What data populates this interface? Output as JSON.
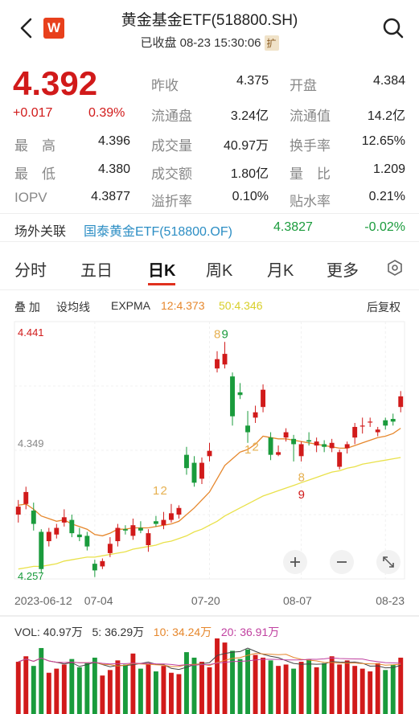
{
  "header": {
    "title": "黄金基金ETF(518800.SH)",
    "status": "已收盘 08-23 15:30:06",
    "ext_badge": "扩",
    "logo": "W"
  },
  "quote": {
    "price": "4.392",
    "change": "+0.017",
    "change_pct": "0.39%",
    "rows": [
      [
        {
          "l": "最　高",
          "v": "4.396"
        },
        {
          "l": "成交量",
          "v": "40.97万"
        },
        {
          "l": "换手率",
          "v": "12.65%"
        }
      ],
      [
        {
          "l": "最　低",
          "v": "4.380"
        },
        {
          "l": "成交额",
          "v": "1.80亿"
        },
        {
          "l": "量　比",
          "v": "1.209"
        }
      ],
      [
        {
          "l": "IOPV",
          "v": "4.3877"
        },
        {
          "l": "溢折率",
          "v": "0.10%"
        },
        {
          "l": "贴水率",
          "v": "0.21%"
        }
      ]
    ],
    "top": [
      {
        "l": "昨收",
        "v": "4.375"
      },
      {
        "l": "开盘",
        "v": "4.384"
      }
    ],
    "second": [
      {
        "l": "流通盘",
        "v": "3.24亿"
      },
      {
        "l": "流通值",
        "v": "14.2亿"
      }
    ]
  },
  "offexchange": {
    "label": "场外关联",
    "fund": "国泰黄金ETF(518800.OF)",
    "nav": "4.3827",
    "pct": "-0.02%"
  },
  "tabs": [
    "分时",
    "五日",
    "日K",
    "周K",
    "月K",
    "更多"
  ],
  "indicators": {
    "overlay": "叠 加",
    "ma": "设均线",
    "expma": "EXPMA",
    "ema12": "12:4.373",
    "ema50": "50:4.346",
    "adjust": "后复权"
  },
  "chart_data": {
    "type": "candlestick",
    "y_labels": [
      "4.441",
      "4.349",
      "4.257"
    ],
    "x_labels": [
      "2023-06-12",
      "07-04",
      "07-20",
      "08-07",
      "08-23"
    ],
    "annotations": [
      "8",
      "9",
      "1",
      "2",
      "1",
      "2",
      "8",
      "9"
    ],
    "candles": [
      {
        "o": 4.303,
        "c": 4.309,
        "h": 4.314,
        "l": 4.297
      },
      {
        "o": 4.311,
        "c": 4.32,
        "h": 4.324,
        "l": 4.307
      },
      {
        "o": 4.306,
        "c": 4.296,
        "h": 4.312,
        "l": 4.291
      },
      {
        "o": 4.29,
        "c": 4.262,
        "h": 4.292,
        "l": 4.259
      },
      {
        "o": 4.283,
        "c": 4.29,
        "h": 4.293,
        "l": 4.279
      },
      {
        "o": 4.288,
        "c": 4.293,
        "h": 4.296,
        "l": 4.285
      },
      {
        "o": 4.297,
        "c": 4.301,
        "h": 4.307,
        "l": 4.294
      },
      {
        "o": 4.299,
        "c": 4.289,
        "h": 4.303,
        "l": 4.286
      },
      {
        "o": 4.288,
        "c": 4.286,
        "h": 4.293,
        "l": 4.283
      },
      {
        "o": 4.287,
        "c": 4.279,
        "h": 4.29,
        "l": 4.276
      },
      {
        "o": 4.266,
        "c": 4.261,
        "h": 4.269,
        "l": 4.256
      },
      {
        "o": 4.264,
        "c": 4.268,
        "h": 4.27,
        "l": 4.262
      },
      {
        "o": 4.274,
        "c": 4.281,
        "h": 4.286,
        "l": 4.271
      },
      {
        "o": 4.283,
        "c": 4.293,
        "h": 4.296,
        "l": 4.279
      },
      {
        "o": 4.292,
        "c": 4.291,
        "h": 4.295,
        "l": 4.288
      },
      {
        "o": 4.287,
        "c": 4.295,
        "h": 4.3,
        "l": 4.284
      },
      {
        "o": 4.293,
        "c": 4.291,
        "h": 4.298,
        "l": 4.289
      },
      {
        "o": 4.28,
        "c": 4.289,
        "h": 4.292,
        "l": 4.275
      },
      {
        "o": 4.298,
        "c": 4.296,
        "h": 4.302,
        "l": 4.294
      },
      {
        "o": 4.295,
        "c": 4.299,
        "h": 4.305,
        "l": 4.292
      },
      {
        "o": 4.299,
        "c": 4.304,
        "h": 4.311,
        "l": 4.297
      },
      {
        "o": 4.303,
        "c": 4.308,
        "h": 4.31,
        "l": 4.3
      },
      {
        "o": 4.348,
        "c": 4.338,
        "h": 4.354,
        "l": 4.333
      },
      {
        "o": 4.342,
        "c": 4.327,
        "h": 4.347,
        "l": 4.324
      },
      {
        "o": 4.33,
        "c": 4.342,
        "h": 4.346,
        "l": 4.326
      },
      {
        "o": 4.347,
        "c": 4.351,
        "h": 4.357,
        "l": 4.343
      },
      {
        "o": 4.413,
        "c": 4.42,
        "h": 4.426,
        "l": 4.41
      },
      {
        "o": 4.416,
        "c": 4.424,
        "h": 4.433,
        "l": 4.413
      },
      {
        "o": 4.407,
        "c": 4.377,
        "h": 4.41,
        "l": 4.37
      },
      {
        "o": 4.395,
        "c": 4.393,
        "h": 4.402,
        "l": 4.39
      },
      {
        "o": 4.37,
        "c": 4.365,
        "h": 4.381,
        "l": 4.357
      },
      {
        "o": 4.376,
        "c": 4.38,
        "h": 4.385,
        "l": 4.372
      },
      {
        "o": 4.384,
        "c": 4.397,
        "h": 4.401,
        "l": 4.38
      },
      {
        "o": 4.361,
        "c": 4.348,
        "h": 4.365,
        "l": 4.344
      },
      {
        "o": 4.348,
        "c": 4.35,
        "h": 4.355,
        "l": 4.347
      },
      {
        "o": 4.361,
        "c": 4.365,
        "h": 4.368,
        "l": 4.358
      },
      {
        "o": 4.36,
        "c": 4.356,
        "h": 4.363,
        "l": 4.343
      },
      {
        "o": 4.347,
        "c": 4.356,
        "h": 4.358,
        "l": 4.343
      },
      {
        "o": 4.359,
        "c": 4.358,
        "h": 4.365,
        "l": 4.355
      },
      {
        "o": 4.355,
        "c": 4.358,
        "h": 4.361,
        "l": 4.35
      },
      {
        "o": 4.356,
        "c": 4.354,
        "h": 4.359,
        "l": 4.35
      },
      {
        "o": 4.353,
        "c": 4.357,
        "h": 4.36,
        "l": 4.35
      },
      {
        "o": 4.339,
        "c": 4.35,
        "h": 4.352,
        "l": 4.337
      },
      {
        "o": 4.353,
        "c": 4.356,
        "h": 4.358,
        "l": 4.349
      },
      {
        "o": 4.361,
        "c": 4.369,
        "h": 4.372,
        "l": 4.356
      },
      {
        "o": 4.37,
        "c": 4.37,
        "h": 4.376,
        "l": 4.364
      },
      {
        "o": 4.373,
        "c": 4.373,
        "h": 4.376,
        "l": 4.369
      },
      {
        "o": 4.365,
        "c": 4.367,
        "h": 4.369,
        "l": 4.362
      },
      {
        "o": 4.374,
        "c": 4.37,
        "h": 4.376,
        "l": 4.367
      },
      {
        "o": 4.375,
        "c": 4.373,
        "h": 4.379,
        "l": 4.37
      },
      {
        "o": 4.384,
        "c": 4.392,
        "h": 4.396,
        "l": 4.38
      }
    ],
    "ema12": [
      4.31,
      4.311,
      4.307,
      4.302,
      4.3,
      4.298,
      4.299,
      4.296,
      4.294,
      4.292,
      4.288,
      4.287,
      4.289,
      4.292,
      4.292,
      4.293,
      4.293,
      4.293,
      4.294,
      4.295,
      4.296,
      4.298,
      4.303,
      4.308,
      4.314,
      4.32,
      4.33,
      4.34,
      4.345,
      4.35,
      4.352,
      4.356,
      4.362,
      4.361,
      4.36,
      4.36,
      4.359,
      4.358,
      4.357,
      4.356,
      4.355,
      4.354,
      4.353,
      4.353,
      4.355,
      4.357,
      4.359,
      4.361,
      4.362,
      4.364,
      4.368
    ],
    "ema50": [
      4.262,
      4.263,
      4.264,
      4.264,
      4.265,
      4.266,
      4.268,
      4.269,
      4.27,
      4.271,
      4.271,
      4.272,
      4.273,
      4.274,
      4.275,
      4.277,
      4.278,
      4.279,
      4.28,
      4.282,
      4.283,
      4.285,
      4.287,
      4.29,
      4.292,
      4.295,
      4.298,
      4.302,
      4.305,
      4.308,
      4.311,
      4.314,
      4.317,
      4.319,
      4.321,
      4.323,
      4.325,
      4.327,
      4.329,
      4.331,
      4.333,
      4.335,
      4.336,
      4.338,
      4.339,
      4.341,
      4.342,
      4.343,
      4.344,
      4.345,
      4.346
    ],
    "volume": {
      "label": "VOL: 40.97万",
      "ma5": "5: 36.29万",
      "ma10": "10: 34.24万",
      "ma20": "20: 36.91万"
    }
  },
  "colors": {
    "up": "#d11a1a",
    "down": "#1a9b3c",
    "ema12": "#e6872c",
    "ema50": "#e9e14a"
  }
}
